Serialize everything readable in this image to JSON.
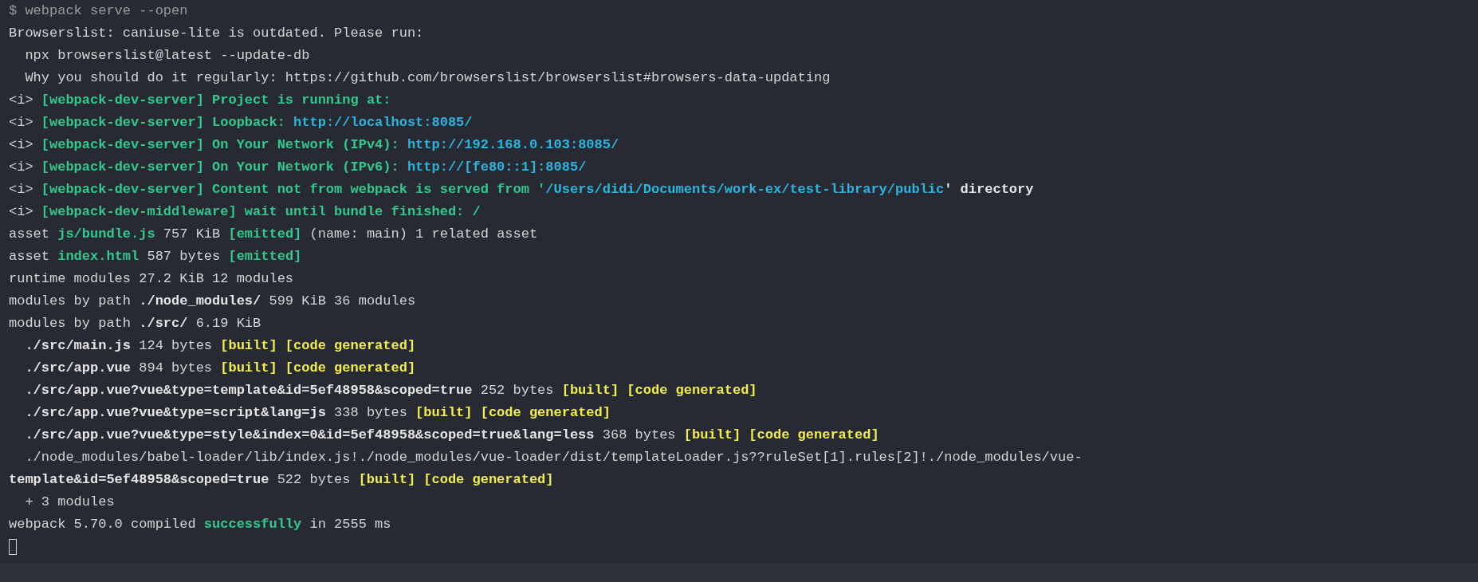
{
  "terminal": {
    "lines": [
      [
        {
          "text": "$ webpack serve --open",
          "kind": "dim"
        }
      ],
      [
        {
          "text": "Browserslist: caniuse-lite is outdated. Please run:",
          "kind": "plain"
        }
      ],
      [
        {
          "text": "  npx browserslist@latest --update-db",
          "kind": "plain"
        }
      ],
      [
        {
          "text": "  Why you should do it regularly: https://github.com/browserslist/browserslist#browsers-data-updating",
          "kind": "plain"
        }
      ],
      [
        {
          "text": "<i> ",
          "kind": "plain"
        },
        {
          "text": "[webpack-dev-server] Project is running at:",
          "kind": "green"
        }
      ],
      [
        {
          "text": "<i> ",
          "kind": "plain"
        },
        {
          "text": "[webpack-dev-server] Loopback: ",
          "kind": "green"
        },
        {
          "text": "http://localhost:8085/",
          "kind": "cyan"
        }
      ],
      [
        {
          "text": "<i> ",
          "kind": "plain"
        },
        {
          "text": "[webpack-dev-server] On Your Network (IPv4): ",
          "kind": "green"
        },
        {
          "text": "http://192.168.0.103:8085/",
          "kind": "cyan"
        }
      ],
      [
        {
          "text": "<i> ",
          "kind": "plain"
        },
        {
          "text": "[webpack-dev-server] On Your Network (IPv6): ",
          "kind": "green"
        },
        {
          "text": "http://[fe80::1]:8085/",
          "kind": "cyan"
        }
      ],
      [
        {
          "text": "<i> ",
          "kind": "plain"
        },
        {
          "text": "[webpack-dev-server] Content not from webpack is served from '",
          "kind": "green"
        },
        {
          "text": "/Users/didi/Documents/work-ex/test-library/public",
          "kind": "cyan"
        },
        {
          "text": "' directory",
          "kind": "bold"
        }
      ],
      [
        {
          "text": "<i> ",
          "kind": "plain"
        },
        {
          "text": "[webpack-dev-middleware] wait until bundle finished: /",
          "kind": "green"
        }
      ],
      [
        {
          "text": "asset ",
          "kind": "plain"
        },
        {
          "text": "js/bundle.js",
          "kind": "green"
        },
        {
          "text": " 757 KiB ",
          "kind": "plain"
        },
        {
          "text": "[emitted]",
          "kind": "green"
        },
        {
          "text": " (name: main) 1 related asset",
          "kind": "plain"
        }
      ],
      [
        {
          "text": "asset ",
          "kind": "plain"
        },
        {
          "text": "index.html",
          "kind": "green"
        },
        {
          "text": " 587 bytes ",
          "kind": "plain"
        },
        {
          "text": "[emitted]",
          "kind": "green"
        }
      ],
      [
        {
          "text": "runtime modules 27.2 KiB 12 modules",
          "kind": "plain"
        }
      ],
      [
        {
          "text": "modules by path ",
          "kind": "plain"
        },
        {
          "text": "./node_modules/",
          "kind": "bold"
        },
        {
          "text": " 599 KiB 36 modules",
          "kind": "plain"
        }
      ],
      [
        {
          "text": "modules by path ",
          "kind": "plain"
        },
        {
          "text": "./src/",
          "kind": "bold"
        },
        {
          "text": " 6.19 KiB",
          "kind": "plain"
        }
      ],
      [
        {
          "text": "  ./src/main.js",
          "kind": "bold"
        },
        {
          "text": " 124 bytes ",
          "kind": "plain"
        },
        {
          "text": "[built] [code generated]",
          "kind": "yellow"
        }
      ],
      [
        {
          "text": "  ./src/app.vue",
          "kind": "bold"
        },
        {
          "text": " 894 bytes ",
          "kind": "plain"
        },
        {
          "text": "[built] [code generated]",
          "kind": "yellow"
        }
      ],
      [
        {
          "text": "  ./src/app.vue?vue&type=template&id=5ef48958&scoped=true",
          "kind": "bold"
        },
        {
          "text": " 252 bytes ",
          "kind": "plain"
        },
        {
          "text": "[built] [code generated]",
          "kind": "yellow"
        }
      ],
      [
        {
          "text": "  ./src/app.vue?vue&type=script&lang=js",
          "kind": "bold"
        },
        {
          "text": " 338 bytes ",
          "kind": "plain"
        },
        {
          "text": "[built] [code generated]",
          "kind": "yellow"
        }
      ],
      [
        {
          "text": "  ./src/app.vue?vue&type=style&index=0&id=5ef48958&scoped=true&lang=less",
          "kind": "bold"
        },
        {
          "text": " 368 bytes ",
          "kind": "plain"
        },
        {
          "text": "[built] [code generated]",
          "kind": "yellow"
        }
      ],
      [
        {
          "text": "  ./node_modules/babel-loader/lib/index.js!./node_modules/vue-loader/dist/templateLoader.js??ruleSet[1].rules[2]!./node_modules/vue-",
          "kind": "plain"
        }
      ],
      [
        {
          "text": "template&id=5ef48958&scoped=true",
          "kind": "bold"
        },
        {
          "text": " 522 bytes ",
          "kind": "plain"
        },
        {
          "text": "[built] [code generated]",
          "kind": "yellow"
        }
      ],
      [
        {
          "text": "  + 3 modules",
          "kind": "plain"
        }
      ],
      [
        {
          "text": "webpack 5.70.0 compiled ",
          "kind": "plain"
        },
        {
          "text": "successfully",
          "kind": "green"
        },
        {
          "text": " in 2555 ms",
          "kind": "plain"
        }
      ]
    ]
  }
}
